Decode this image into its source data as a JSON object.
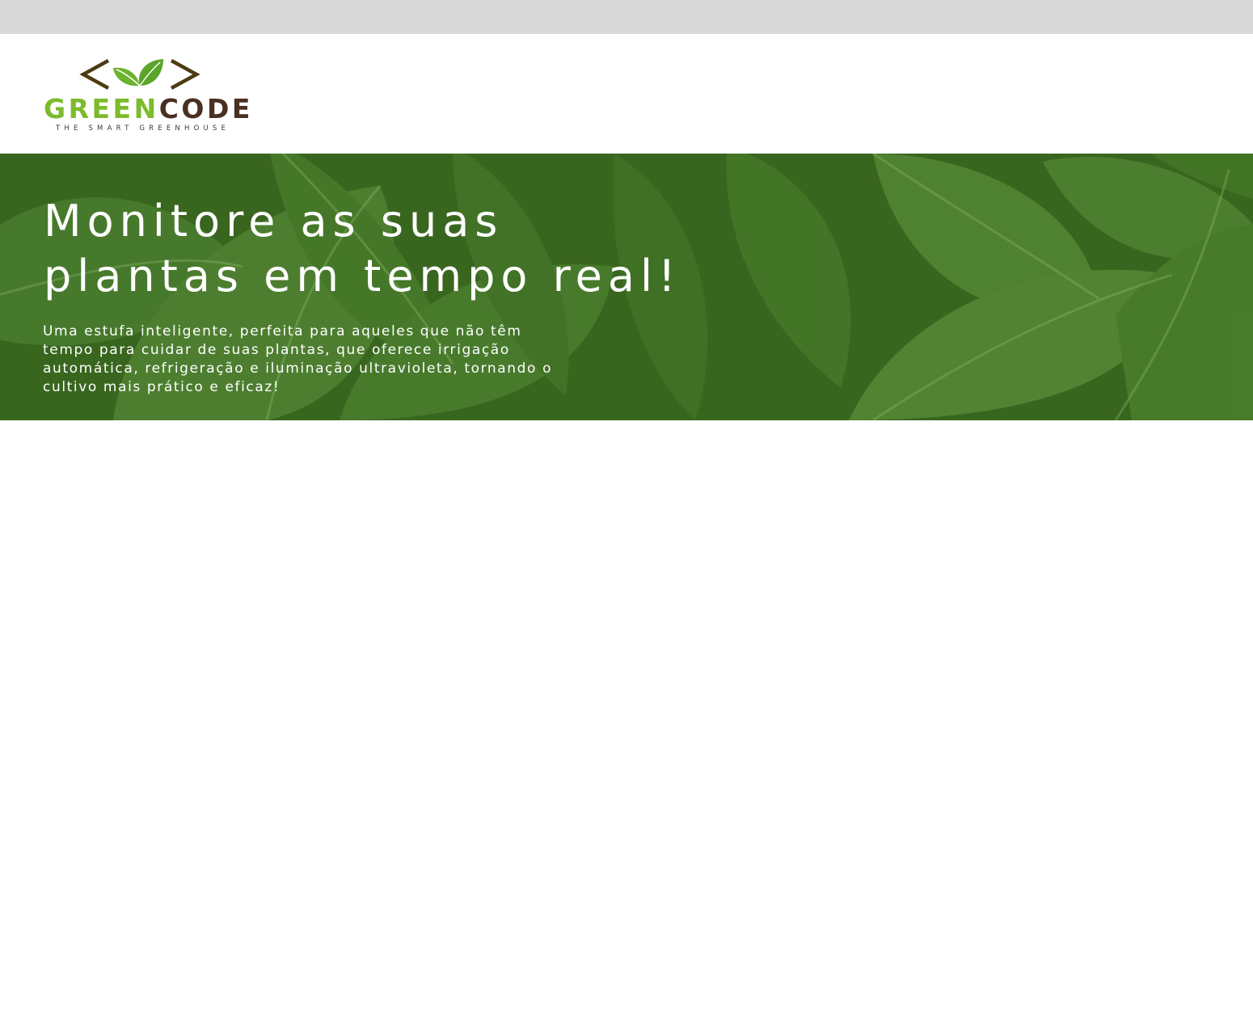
{
  "logo": {
    "word_green": "GREEN",
    "word_brown": "CODE",
    "tagline": "THE SMART GREENHOUSE",
    "icon": "code-brackets-leaf-icon",
    "colors": {
      "green": "#7dbb2c",
      "brown": "#4a2f22",
      "bracket": "#4d3a12"
    }
  },
  "hero": {
    "title_lines": [
      "Monitore as suas",
      "plantas em tempo real!"
    ],
    "text_lines": [
      "Uma estufa inteligente, perfeita para aqueles que não têm",
      "tempo para cuidar de suas plantas, que oferece irrigação",
      "automática, refrigeração e iluminação ultravioleta, tornando o",
      "cultivo mais prático e eficaz!"
    ],
    "background": "monstera-leaves-image",
    "colors": {
      "overlay": "#3e6b24",
      "text": "#ffffff"
    }
  },
  "colors": {
    "topbar": "#d9d9d9",
    "page": "#ffffff"
  }
}
